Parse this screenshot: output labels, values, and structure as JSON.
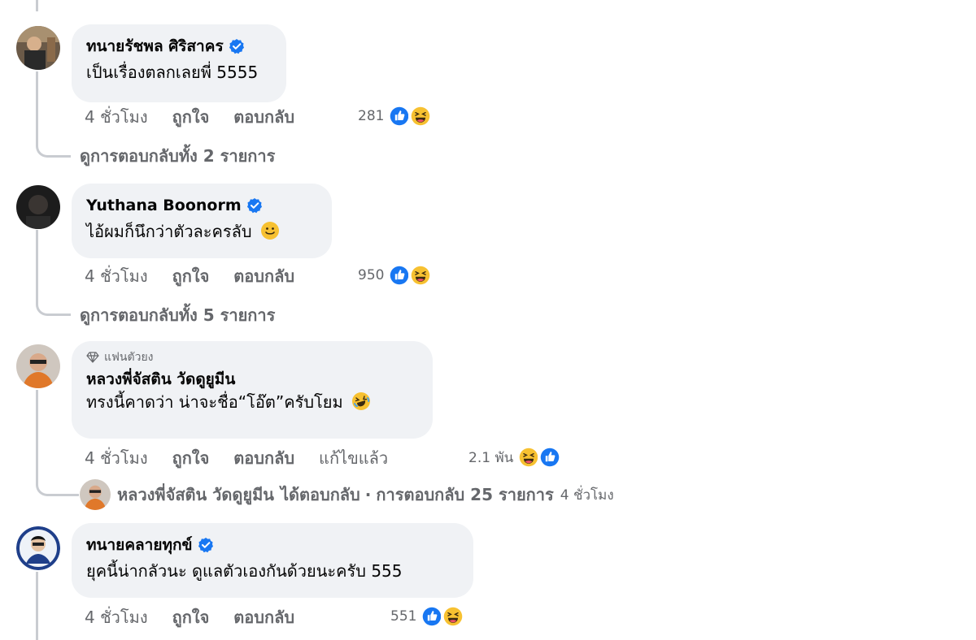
{
  "comments": [
    {
      "author": "ทนายรัชพล ศิริสาคร",
      "text": "เป็นเรื่องตลกเลยพี่ 5555",
      "time": "4 ชั่วโมง",
      "like": "ถูกใจ",
      "reply": "ตอบกลับ",
      "reaction_count": "281",
      "reactions": [
        "like-icon",
        "haha-icon"
      ],
      "view_replies": "ดูการตอบกลับทั้ง 2 รายการ"
    },
    {
      "author": "Yuthana Boonorm",
      "text": "ไอ้ผมก็นึกว่าตัวละครลับ",
      "time": "4 ชั่วโมง",
      "like": "ถูกใจ",
      "reply": "ตอบกลับ",
      "reaction_count": "950",
      "reactions": [
        "like-icon",
        "haha-icon"
      ],
      "view_replies": "ดูการตอบกลับทั้ง 5 รายการ"
    },
    {
      "badge": "แฟนตัวยง",
      "author": "หลวงพี่จัสติน วัดดูยูมีน",
      "text": "ทรงนี้คาดว่า น่าจะชื่อ“โอ๊ต”ครับโยม",
      "time": "4 ชั่วโมง",
      "like": "ถูกใจ",
      "reply": "ตอบกลับ",
      "edited": "แก้ไขแล้ว",
      "reaction_count": "2.1 พัน",
      "reactions": [
        "haha-icon",
        "like-icon"
      ],
      "reply_summary": {
        "author": "หลวงพี่จัสติน วัดดูยูมีน",
        "replied": "ได้ตอบกลับ",
        "sep": "·",
        "count": "การตอบกลับ 25 รายการ",
        "time": "4 ชั่วโมง"
      }
    },
    {
      "author": "ทนายคลายทุกข์",
      "text": "ยุคนี้น่ากลัวนะ ดูแลตัวเองกันด้วยนะครับ 555",
      "time": "4 ชั่วโมง",
      "like": "ถูกใจ",
      "reply": "ตอบกลับ",
      "reaction_count": "551",
      "reactions": [
        "like-icon",
        "haha-icon"
      ]
    }
  ],
  "colors": {
    "bubble": "#f0f2f5",
    "secondary_text": "#65676b",
    "verified_blue": "#1877f2",
    "haha_yellow": "#f7c131"
  }
}
